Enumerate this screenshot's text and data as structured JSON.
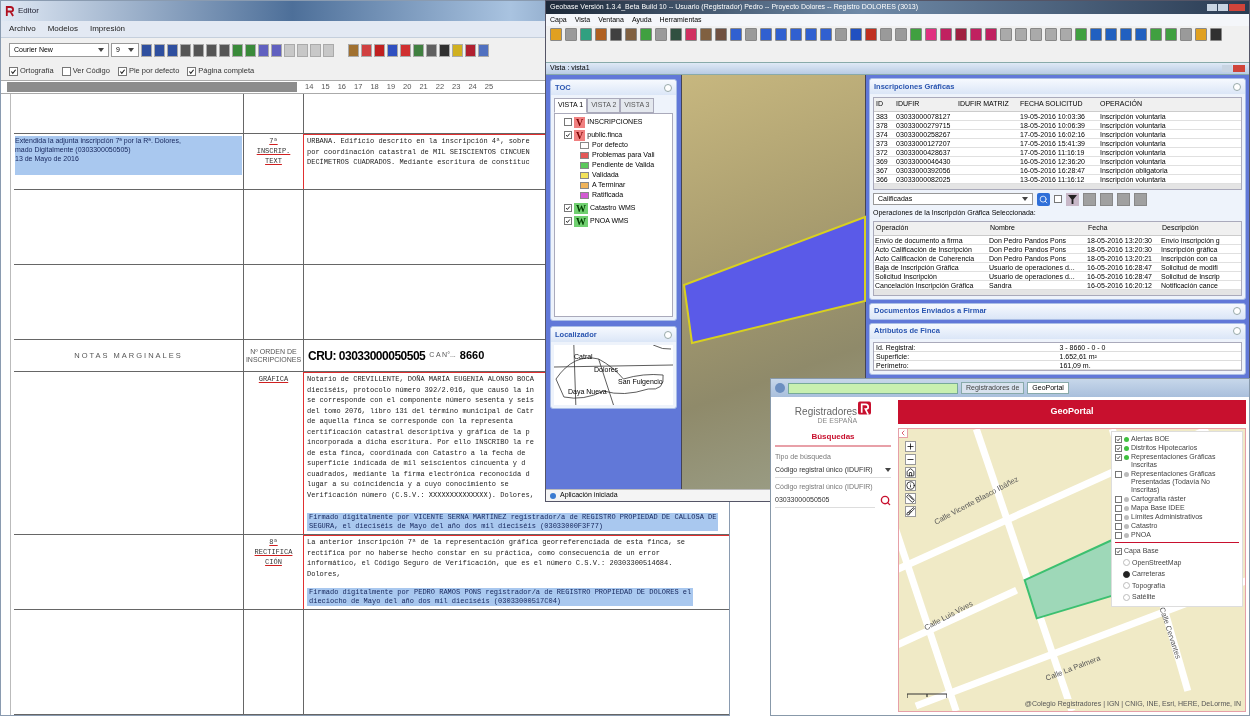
{
  "editor": {
    "title": "Editor",
    "menu": [
      "Archivo",
      "Modelos",
      "Impresión"
    ],
    "font": "Courier New",
    "size": "9",
    "options": [
      {
        "label": "Ortografía",
        "checked": true
      },
      {
        "label": "Ver Código",
        "checked": false
      },
      {
        "label": "Pie por defecto",
        "checked": true
      },
      {
        "label": "Página completa",
        "checked": true
      }
    ],
    "ruler": [
      "14",
      "15",
      "16",
      "17",
      "18",
      "19",
      "20",
      "21",
      "22",
      "23",
      "24",
      "25"
    ],
    "rows": [
      {
        "kind": "blank"
      },
      {
        "kind": "entry",
        "notes": {
          "selected": true,
          "lines": [
            "Extendida la adjunta inscripción 7ª por la Rª. Dolores,",
            "mado Digitalmente (0303300050505)",
            "13 de Mayo de 2016"
          ]
        },
        "order": [
          "7ª",
          "INSCRIP.",
          "TEXT"
        ],
        "text": [
          "URBANA. Edificio descrito en la inscripción 4ª, sobre",
          "por coordinación catastral de MIL SEISCIENTOS CINCUEN",
          "DECÍMETROS CUADRADOS. Mediante escritura de constituc"
        ]
      },
      {
        "kind": "blank"
      },
      {
        "kind": "blank"
      },
      {
        "kind": "header",
        "notes": "NOTAS MARGINALES",
        "order": "Nº ORDEN DE INSCRIPCIONES",
        "cru": "CRU: 03033000050505",
        "can": "C A N°...",
        "number": "8660"
      },
      {
        "kind": "entry",
        "order": [
          "GRÁFICA"
        ],
        "text": [
          "Notario de CREVILLENTE, DOÑA MARÍA EUGENIA ALONSO BOCA",
          "dieciséis, protocolo número 392/2.016, que causó la in",
          "se corresponde con el componente número sesenta y seis",
          "del tomo 2076, libro 131 del término municipal de Catr",
          "de aquella finca se corresponde con la representa",
          "certificación catastral descriptiva y gráfica de la p",
          "incorporada a dicha escritura. Por ello INSCRIBO la re",
          "de esta finca, coordinada con Catastro a la fecha de",
          "superficie indicada de mil seiscientos cincuenta y d",
          "cuadrados, mediante la firma electrónica reconocida d",
          "lugar a su coincidencia y a cuyo conocimiento se",
          "Verificación número (C.S.V.: XXXXXXXXXXXXXX). Dolores,"
        ],
        "signature": [
          "Firmado digitalmente por VICENTE SERNA MARTÍNEZ registrador/a de REGISTRO PROPIEDAD DE CALLOSA DE",
          "SEGURA, el dieciséis de Mayo del año dos mil dieciséis (03033000F3F77)"
        ]
      },
      {
        "kind": "entry",
        "order": [
          "8ª",
          "RECTIFICA",
          "CIÓN"
        ],
        "text": [
          "La anterior inscripción 7ª de la representación gráfica georreferenciada de esta finca, se",
          "rectifica por no haberse hecho constar en su práctica, como consecuencia de un error",
          "informático, el Código Seguro de Verificación, que es el número C.S.V.: 20303300514684.",
          "Dolores,"
        ],
        "signature": [
          "Firmado digitalmente por PEDRO RAMOS PONS registrador/a de REGISTRO PROPIEDAD DE DOLORES el",
          "dieciocho de Mayo del año dos mil dieciséis (03033000517C04)"
        ]
      },
      {
        "kind": "blank"
      }
    ]
  },
  "geobase": {
    "title": "Geobase Versión 1.3.4_Beta Build 10 -- Usuario (Registrador) Pedro -- Proyecto Dolores -- Registro DOLORES (3013)",
    "menu": [
      "Capa",
      "Vista",
      "Ventana",
      "Ayuda",
      "Herramientas"
    ],
    "subwindow": "Vista : vista1",
    "toc": {
      "title": "TOC",
      "tabs": [
        {
          "label": "VISTA 1",
          "selected": true
        },
        {
          "label": "VISTA 2",
          "selected": false
        },
        {
          "label": "VISTA 3",
          "selected": false
        }
      ],
      "layers": [
        {
          "name": "INSCRIPCIONES",
          "kind": "vector",
          "badge": "V",
          "checked": false
        },
        {
          "name": "public.finca",
          "kind": "vector",
          "badge": "V",
          "checked": true,
          "legend": [
            {
              "label": "Por defecto",
              "color": "#ffffff"
            },
            {
              "label": "Problemas para Vali",
              "color": "#e45858"
            },
            {
              "label": "Pendiente de Valida",
              "color": "#5cc85c"
            },
            {
              "label": "Validada",
              "color": "#f2e25a"
            },
            {
              "label": "A Terminar",
              "color": "#f0b45a"
            },
            {
              "label": "Ratificada",
              "color": "#d25ad2"
            }
          ]
        },
        {
          "name": "Catastro WMS",
          "kind": "wms",
          "badge": "W",
          "checked": true
        },
        {
          "name": "PNOA WMS",
          "kind": "wms",
          "badge": "W",
          "checked": true
        }
      ]
    },
    "locator": {
      "title": "Localizador",
      "places": [
        "Catral",
        "Dolores",
        "San Fulgencio",
        "Daya Nueva"
      ]
    },
    "status": "Aplicación iniciada",
    "inscriptions": {
      "title": "Inscripciones Gráficas",
      "columns": [
        "ID",
        "IDUFIR",
        "IDUFIR MATRIZ",
        "FECHA SOLICITUD",
        "OPERACIÓN"
      ],
      "rows": [
        [
          "383",
          "03033000078127",
          "",
          "19-05-2016 10:03:36",
          "Inscripción voluntaria"
        ],
        [
          "378",
          "03033000279715",
          "",
          "18-05-2016 10:06:39",
          "Inscripción voluntaria"
        ],
        [
          "374",
          "03033000258267",
          "",
          "17-05-2016 16:02:16",
          "Inscripción voluntaria"
        ],
        [
          "373",
          "03033000127207",
          "",
          "17-05-2016 15:41:39",
          "Inscripción voluntaria"
        ],
        [
          "372",
          "03033000428637",
          "",
          "17-05-2016 11:16:19",
          "Inscripción voluntaria"
        ],
        [
          "369",
          "03033000046430",
          "",
          "16-05-2016 12:36:20",
          "Inscripción voluntaria"
        ],
        [
          "367",
          "03033000392056",
          "",
          "16-05-2016 16:28:47",
          "Inscripción obligatoria"
        ],
        [
          "366",
          "03033000082025",
          "",
          "13-05-2016 11:16:12",
          "Inscripción voluntaria"
        ]
      ]
    },
    "filter": "Calificadas",
    "filter_checked": false,
    "operations_label": "Operaciones de la Inscripción Gráfica Seleccionada:",
    "operations": {
      "columns": [
        "Operación",
        "Nombre",
        "Fecha",
        "Descripción"
      ],
      "rows": [
        [
          "Envío de documento a firma",
          "Don Pedro Pandos Pons",
          "18-05-2016 13:20:30",
          "Envío inscripción g"
        ],
        [
          "Acto Calificación de Inscripción",
          "Don Pedro Pandos Pons",
          "18-05-2016 13:20:30",
          "Inscripción gráfica"
        ],
        [
          "Acto Calificación de Coherencia",
          "Don Pedro Pandos Pons",
          "18-05-2016 13:20:21",
          "Inscripción con ca"
        ],
        [
          "Baja de Inscripción Gráfica",
          "Usuario de operaciones d...",
          "16-05-2016 16:28:47",
          "Solicitud de modifi"
        ],
        [
          "Solicitud Inscripción",
          "Usuario de operaciones d...",
          "16-05-2016 16:28:47",
          "Solicitud de Inscrip"
        ],
        [
          "Cancelación Inscripción Gráfica",
          "Sandra",
          "16-05-2016 16:20:12",
          "Notificación cance"
        ]
      ]
    },
    "documents_title": "Documentos Enviados a Firmar",
    "attributes": {
      "title": "Atributos de Finca",
      "rows": [
        [
          "Id. Registral:",
          "3 - 8660 - 0 - 0"
        ],
        [
          "Superficie:",
          "1.652,61 m²"
        ],
        [
          "Perímetro:",
          "161,09 m."
        ]
      ]
    }
  },
  "portal": {
    "tabs": [
      {
        "label": "Registradores de",
        "selected": false
      },
      {
        "label": "GeoPortal",
        "selected": true
      }
    ],
    "brand": "Registradores",
    "brand_sub": "DE ESPAÑA",
    "search_tab": "Búsquedas",
    "type_label": "Tipo de búsqueda",
    "type_value": "Código registral único (IDUFIR)",
    "code_label": "Código registral único (IDUFIR)",
    "code_value": "03033000050505",
    "header": "GeoPortal",
    "streets": [
      "Calle Vicente Blasco Ibáñez",
      "Calle Luis Vives",
      "Calle Cervantes",
      "Calle La Palmera"
    ],
    "layers": [
      {
        "label": "Alertas BOE",
        "checked": true
      },
      {
        "label": "Distritos Hipotecarios",
        "checked": true
      },
      {
        "label": "Representaciones Gráficas Inscritas",
        "checked": true
      },
      {
        "label": "Representaciones Gráficas Presentadas (Todavía No Inscritas)",
        "checked": false
      },
      {
        "label": "Cartografía ráster",
        "checked": false
      },
      {
        "label": "Mapa Base IDEE",
        "checked": false
      },
      {
        "label": "Límites Administrativos",
        "checked": false
      },
      {
        "label": "Catastro",
        "checked": false
      },
      {
        "label": "PNOA",
        "checked": false
      }
    ],
    "base": {
      "label": "Capa Base",
      "checked": true,
      "options": [
        {
          "label": "OpenStreetMap",
          "selected": false
        },
        {
          "label": "Carreteras",
          "selected": true
        },
        {
          "label": "Topografía",
          "selected": false
        },
        {
          "label": "Satélite",
          "selected": false
        }
      ]
    },
    "attribution": "@Colegio Registradores | IGN | CNIG, INE, Esri, HERE, DeLorme, IN"
  }
}
